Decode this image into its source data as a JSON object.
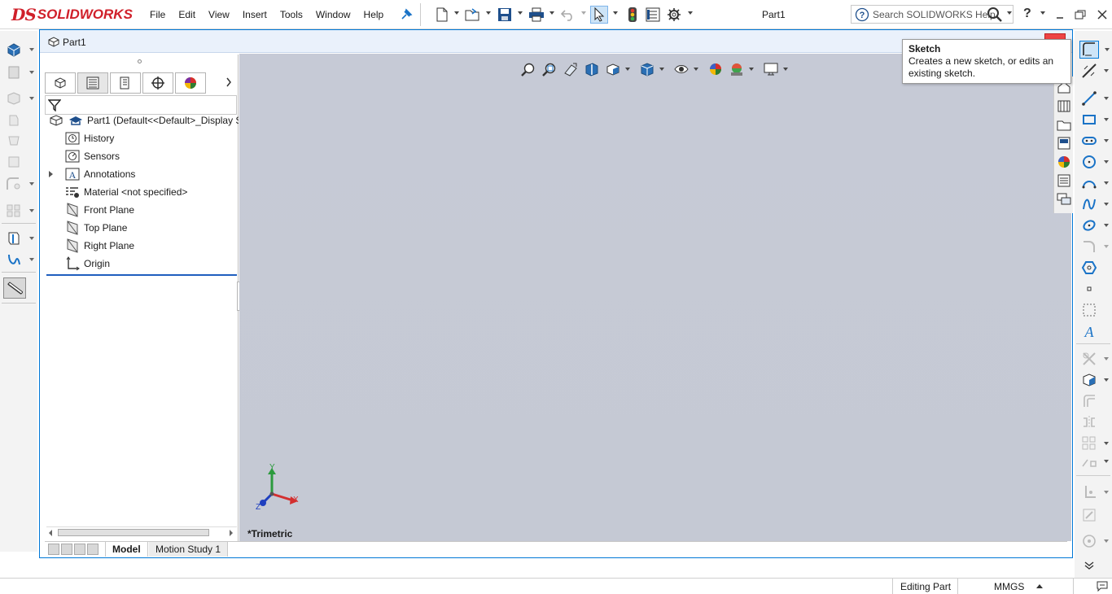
{
  "app": {
    "brand_ds": "DS",
    "brand_name": "SOLIDWORKS"
  },
  "menu": [
    "File",
    "Edit",
    "View",
    "Insert",
    "Tools",
    "Window",
    "Help"
  ],
  "title": "Part1",
  "search": {
    "placeholder": "Search SOLIDWORKS Help"
  },
  "help_label": "?",
  "document": {
    "tab_title": "Part1"
  },
  "feature_tree": {
    "root": "Part1  (Default<<Default>_Display S",
    "items": [
      {
        "label": "History",
        "icon": "history-icon"
      },
      {
        "label": "Sensors",
        "icon": "sensors-icon"
      },
      {
        "label": "Annotations",
        "icon": "annotations-icon"
      },
      {
        "label": "Material <not specified>",
        "icon": "material-icon"
      },
      {
        "label": "Front Plane",
        "icon": "plane-icon"
      },
      {
        "label": "Top Plane",
        "icon": "plane-icon"
      },
      {
        "label": "Right Plane",
        "icon": "plane-icon"
      },
      {
        "label": "Origin",
        "icon": "origin-icon"
      }
    ]
  },
  "viewport": {
    "view_label": "*Trimetric",
    "triad": {
      "x": "X",
      "y": "Y",
      "z": "Z"
    }
  },
  "bottom_tabs": [
    "Model",
    "Motion Study 1"
  ],
  "status": {
    "mode": "Editing Part",
    "units": "MMGS"
  },
  "tooltip": {
    "title": "Sketch",
    "body": "Creates a new sketch, or edits an existing sketch."
  },
  "colors": {
    "accent": "#0078d7",
    "brand_red": "#d0202a",
    "viewport_bg": "#c6cad6"
  }
}
